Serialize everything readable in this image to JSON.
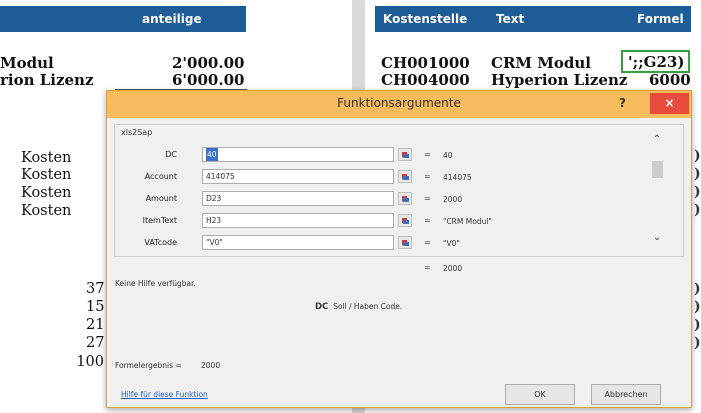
{
  "spreadsheet": {
    "header_left": "anteilige Kosten",
    "header_right": {
      "col1": "Kostenstelle",
      "col2": "Text",
      "col3": "Formel"
    },
    "left_rows": [
      {
        "label": "Modul",
        "value": "2'000.00"
      },
      {
        "label": "rion Lizenz",
        "value": "6'000.00"
      }
    ],
    "right_rows": [
      {
        "code": "CH001000",
        "text": "CRM Modul",
        "formula": "';;G23)"
      },
      {
        "code": "CH004000",
        "text": "Hyperion Lizenz",
        "formula": "6000"
      }
    ],
    "kosten_labels": [
      "Kosten",
      "Kosten",
      "Kosten",
      "Kosten"
    ],
    "numbers": [
      "37",
      "15",
      "21",
      "27",
      "100"
    ],
    "right_edge_marks": [
      ")",
      ")",
      ")",
      ")",
      ")",
      ")",
      ")",
      ")"
    ]
  },
  "dialog": {
    "title": "Funktionsargumente",
    "help_label": "?",
    "close_label": "×",
    "function_name": "xls2Sap",
    "arguments": [
      {
        "label": "DC",
        "value": "40",
        "result": "40"
      },
      {
        "label": "Account",
        "value": "414075",
        "result": "414075"
      },
      {
        "label": "Amount",
        "value": "D23",
        "result": "2000"
      },
      {
        "label": "ItemText",
        "value": "H23",
        "result": "\"CRM Modul\""
      },
      {
        "label": "VATcode",
        "value": "\"V0\"",
        "result": "\"V0\""
      }
    ],
    "eq_sign": "=",
    "function_result": "2000",
    "no_help": "Keine Hilfe verfügbar.",
    "arg_desc_name": "DC",
    "arg_desc_text": "Soll / Haben Code.",
    "formula_result_label": "Formelergebnis =",
    "formula_result_value": "2000",
    "help_link": "Hilfe für diese Funktion",
    "ok_label": "OK",
    "cancel_label": "Abbrechen"
  },
  "colors": {
    "header_blue": "#1f5d99",
    "title_orange": "#f6bb5c",
    "close_red": "#e84a3c",
    "cell_border_green": "#3a9a46",
    "link_blue": "#1f5fc4"
  }
}
